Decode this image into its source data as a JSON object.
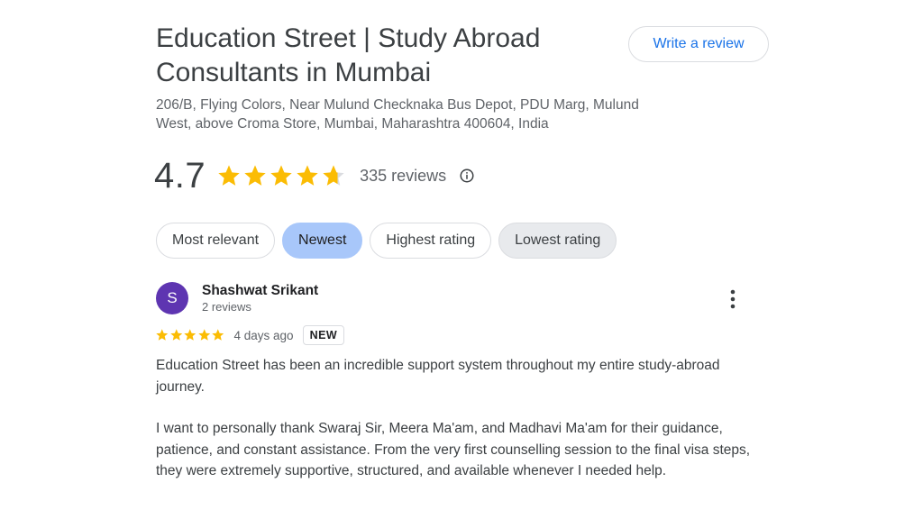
{
  "business": {
    "title": "Education Street | Study Abroad Consultants in Mumbai",
    "address": "206/B, Flying Colors, Near Mulund Checknaka Bus Depot, PDU Marg, Mulund West, above Croma Store, Mumbai, Maharashtra 400604, India",
    "write_review_label": "Write a review"
  },
  "rating": {
    "value": "4.7",
    "stars": 4.7,
    "review_count": "335 reviews",
    "star_color": "#fbbc04",
    "info_icon": "info-icon"
  },
  "sort_chips": [
    {
      "label": "Most relevant",
      "selected": false
    },
    {
      "label": "Newest",
      "selected": true
    },
    {
      "label": "Highest rating",
      "selected": false
    },
    {
      "label": "Lowest rating",
      "selected": false
    }
  ],
  "review": {
    "avatar_letter": "S",
    "avatar_color": "#5e35b1",
    "name": "Shashwat Srikant",
    "reviews_count": "2 reviews",
    "stars": 5,
    "time_ago": "4 days ago",
    "badge": "NEW",
    "paragraphs": [
      "Education Street has been an incredible support system throughout my entire study-abroad journey.",
      "I want to personally thank Swaraj Sir, Meera Ma'am, and Madhavi Ma'am for their guidance, patience, and constant assistance. From the very first counselling session to the final visa steps, they were extremely supportive, structured, and available whenever I needed help."
    ],
    "more_icon": "more-vert-icon"
  }
}
